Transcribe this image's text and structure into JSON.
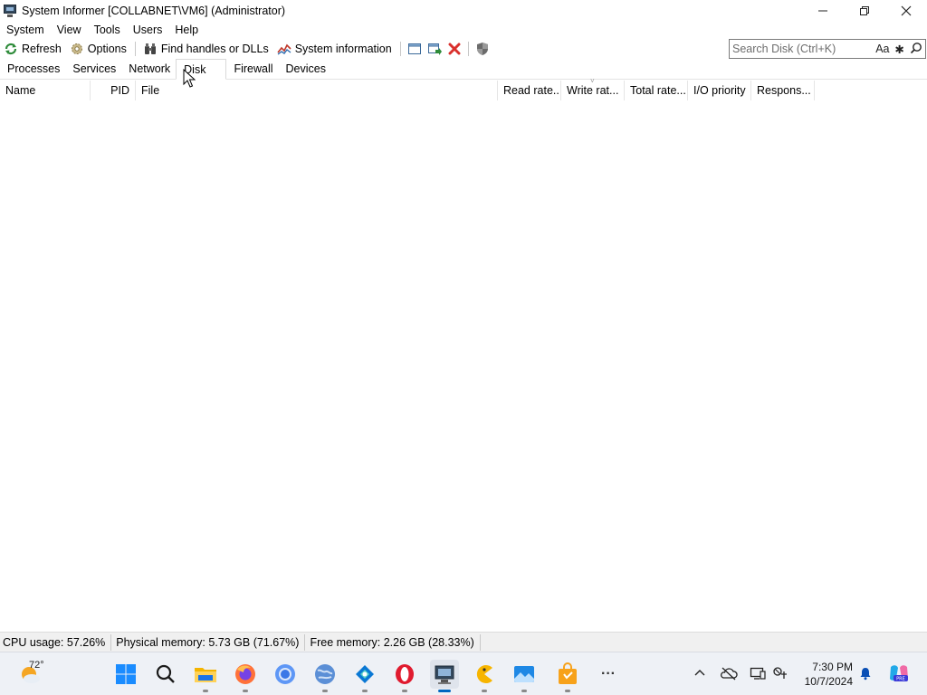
{
  "window": {
    "title": "System Informer [COLLABNET\\VM6] (Administrator)",
    "minimize": "—",
    "restore": "❐",
    "close": "✕"
  },
  "menu": [
    "System",
    "View",
    "Tools",
    "Users",
    "Help"
  ],
  "toolbar": {
    "refresh": "Refresh",
    "options": "Options",
    "find_handles": "Find handles or DLLs",
    "system_information": "System information"
  },
  "search": {
    "placeholder": "Search Disk (Ctrl+K)",
    "value": "",
    "match_case": "Aa",
    "regex": "✱"
  },
  "tabs": {
    "items": [
      "Processes",
      "Services",
      "Network",
      "Disk",
      "Firewall",
      "Devices"
    ],
    "active": "Disk"
  },
  "columns": [
    "Name",
    "PID",
    "File",
    "Read rate...",
    "Write rat...",
    "Total rate...",
    "I/O priority",
    "Respons..."
  ],
  "status": {
    "cpu": "CPU usage: 57.26%",
    "physical": "Physical memory: 5.73 GB (71.67%)",
    "free": "Free memory: 2.26 GB (28.33%)"
  },
  "taskbar": {
    "weather_temp": "72°",
    "time": "7:30 PM",
    "date": "10/7/2024",
    "apps": [
      "start-button",
      "search",
      "file-explorer",
      "firefox",
      "chrome",
      "network-app",
      "copilot-app",
      "opera",
      "system-informer",
      "pacman-app",
      "photos",
      "store"
    ],
    "more": "···"
  },
  "colors": {
    "accent": "#0067c0",
    "status_bg": "#f0f0f0",
    "taskbar_bg": "#eef1f6"
  }
}
